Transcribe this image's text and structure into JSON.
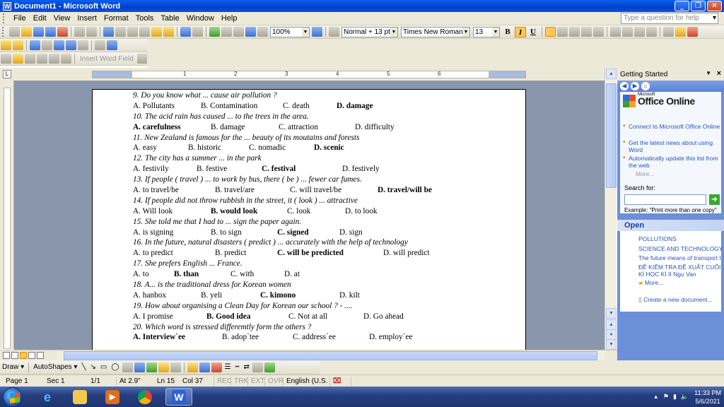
{
  "window": {
    "title": "Document1 - Microsoft Word"
  },
  "menu": {
    "items": [
      "File",
      "Edit",
      "View",
      "Insert",
      "Format",
      "Tools",
      "Table",
      "Window",
      "Help"
    ],
    "help_placeholder": "Type a question for help"
  },
  "toolbar": {
    "zoom": "100%",
    "style": "Normal + 13 pt, I",
    "font": "Times New Roman",
    "size": "13",
    "bold": "B",
    "italic": "I",
    "underline": "U",
    "insert_field": "Insert Word Field"
  },
  "ruler": {
    "numbers": [
      "1",
      "2",
      "3",
      "4",
      "5",
      "6"
    ]
  },
  "document": {
    "lines": [
      {
        "type": "q",
        "text": "9. Do you know what ... cause air pollution ?"
      },
      {
        "type": "o",
        "opts": [
          {
            "t": "A. Pollutants"
          },
          {
            "t": "B. Contamination"
          },
          {
            "t": "C. death"
          },
          {
            "t": "D. damage",
            "b": true
          }
        ]
      },
      {
        "type": "q",
        "text": "10. The acid rain has caused ... to the trees in the area."
      },
      {
        "type": "o",
        "opts": [
          {
            "t": "A. carefulness",
            "b": true
          },
          {
            "t": "B. damage"
          },
          {
            "t": "C. attraction"
          },
          {
            "t": "D. difficulty"
          }
        ]
      },
      {
        "type": "q",
        "text": "11. New Zealand is famous for the ... beauty of its moutains and forests"
      },
      {
        "type": "o",
        "opts": [
          {
            "t": "A. easy"
          },
          {
            "t": "B. historic"
          },
          {
            "t": "C. nomadic"
          },
          {
            "t": "D. scenic",
            "b": true
          }
        ]
      },
      {
        "type": "q",
        "text": "12. The city has a summer ... in the park"
      },
      {
        "type": "o",
        "opts": [
          {
            "t": "A. festivily"
          },
          {
            "t": "B. festive"
          },
          {
            "t": "C. festival",
            "b": true
          },
          {
            "t": "D. festively"
          }
        ]
      },
      {
        "type": "q",
        "text": "13. If people ( travel ) ... to work by bus, there ( be ) ... fewer car fumes."
      },
      {
        "type": "o",
        "opts": [
          {
            "t": "A. to travel/be"
          },
          {
            "t": "B. travel/are"
          },
          {
            "t": "C. will travel/be"
          },
          {
            "t": "D. travel/will be",
            "b": true
          }
        ]
      },
      {
        "type": "q",
        "text": "14. If people did not throw rubbish in the street, it ( look ) ... attractive"
      },
      {
        "type": "o",
        "opts": [
          {
            "t": "A. Will look"
          },
          {
            "t": "B. would look",
            "b": true
          },
          {
            "t": "C. look"
          },
          {
            "t": "D. to look"
          }
        ]
      },
      {
        "type": "q",
        "text": "15. She told me that I had to ... sign the paper again."
      },
      {
        "type": "o",
        "opts": [
          {
            "t": "A. is signing"
          },
          {
            "t": "B. to sign"
          },
          {
            "t": "C. signed",
            "b": true
          },
          {
            "t": "D. sign"
          }
        ]
      },
      {
        "type": "q",
        "text": "16. In the future, natural disasters ( predict ) ... accurately with the help of technology"
      },
      {
        "type": "o",
        "opts": [
          {
            "t": "A. to predict"
          },
          {
            "t": "B. predict"
          },
          {
            "t": "C. will be predicted",
            "b": true
          },
          {
            "t": "D. will predict"
          }
        ]
      },
      {
        "type": "q",
        "text": "17. She prefers English ... France."
      },
      {
        "type": "o",
        "opts": [
          {
            "t": "A. to"
          },
          {
            "t": "B. than",
            "b": true
          },
          {
            "t": "C. with"
          },
          {
            "t": "D. at"
          }
        ]
      },
      {
        "type": "q",
        "text": "18. A... is the traditional dress for Korean women"
      },
      {
        "type": "o",
        "opts": [
          {
            "t": "A. hanbox"
          },
          {
            "t": "B. yeli"
          },
          {
            "t": "C. kimono",
            "b": true
          },
          {
            "t": "D. kilt"
          }
        ]
      },
      {
        "type": "q",
        "text": "19. How about organising a Clean Day for Korean our school ? - ...."
      },
      {
        "type": "o",
        "opts": [
          {
            "t": "A. I promise"
          },
          {
            "t": "B. Good idea",
            "b": true
          },
          {
            "t": "C. Not at all"
          },
          {
            "t": "D. Go ahead"
          }
        ]
      },
      {
        "type": "q",
        "text": "20. Which word is stressed differemtly form the others ?"
      },
      {
        "type": "o",
        "opts": [
          {
            "t": "A. Interview`ee",
            "b": true
          },
          {
            "t": "B. adop`tee"
          },
          {
            "t": "C. address`ee"
          },
          {
            "t": "D. employ`ee"
          }
        ]
      }
    ]
  },
  "taskpane": {
    "title": "Getting Started",
    "brand": "Office Online",
    "brand_small": "Microsoft",
    "links": [
      "Connect to Microsoft Office Online",
      "Get the latest news about using Word",
      "Automatically update this list from the web"
    ],
    "more": "More...",
    "search_label": "Search for:",
    "example": "Example:  \"Print more than one copy\"",
    "open_title": "Open",
    "files": [
      "POLLUTIONS",
      "SCIENCE AND TECHNOLOGY",
      "The future means of transport I",
      "ĐỀ KIỂM TRA ĐỀ XUẤT CUỐI KÌ HỌC KÌ II Ngu Van"
    ],
    "open_more": "More...",
    "create": "Create a new document..."
  },
  "drawbar": {
    "draw": "Draw",
    "autoshapes": "AutoShapes"
  },
  "status": {
    "page": "Page 1",
    "sec": "Sec 1",
    "of": "1/1",
    "at": "At 2.9\"",
    "ln": "Ln 15",
    "col": "Col 37",
    "rec": "REC",
    "trk": "TRK",
    "ext": "EXT",
    "ovr": "OVR",
    "lang": "English (U.S."
  },
  "taskbar": {
    "time": "11:33 PM",
    "date": "5/6/2021"
  }
}
